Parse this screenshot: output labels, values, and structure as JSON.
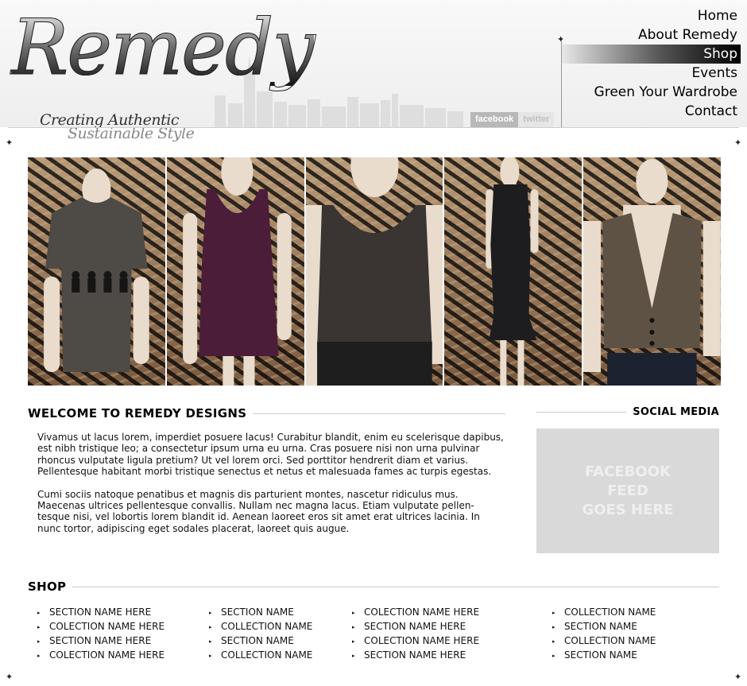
{
  "header": {
    "logo_text": "Remedy",
    "tagline_line1": "Creating Authentic",
    "tagline_line2": "Sustainable Style",
    "social_links": [
      "facebook",
      "twitter"
    ],
    "nav": {
      "items": [
        {
          "label": "Home",
          "active": false
        },
        {
          "label": "About Remedy",
          "active": false
        },
        {
          "label": "Shop",
          "active": true
        },
        {
          "label": "Events",
          "active": false
        },
        {
          "label": "Green Your Wardrobe",
          "active": false
        },
        {
          "label": "Contact",
          "active": false
        }
      ]
    }
  },
  "gallery": {
    "photos": [
      {
        "name": "gray-beatles-tee",
        "garment_color": "#4e4a45"
      },
      {
        "name": "purple-tank-dress",
        "garment_color": "#4c1d38"
      },
      {
        "name": "sequin-tank-top",
        "garment_color": "#3a3432"
      },
      {
        "name": "black-sequin-dress",
        "garment_color": "#1d1d1f"
      },
      {
        "name": "plaid-vest",
        "garment_color": "#5e5244"
      }
    ]
  },
  "welcome": {
    "title": "WELCOME TO REMEDY DESIGNS",
    "paragraphs": [
      "Vivamus ut lacus lorem, imperdiet posuere lacus! Curabitur blandit, enim eu scelerisque dapibus, est nibh tristique leo; a consectetur ipsum urna eu urna. Cras posuere nisi non urna pulvinar rhoncus vulputate ligula pretium? Ut vel lorem orci. Sed porttitor hendrerit diam et varius. Pellentesque habitant morbi tristique senectus et netus et malesuada fames ac turpis egestas.",
      "Cumi sociis natoque penatibus et magnis dis parturient montes, nascetur ridiculus mus. Maecenas ultrices pellentesque convallis. Nullam nec magna lacus. Etiam vulputate pellen-tesque nisi, vel lobortis lorem blandit id. Aenean laoreet eros sit amet erat ultrices lacinia. In nunc tortor, adipiscing eget sodales placerat, laoreet quis augue."
    ]
  },
  "social": {
    "title": "SOCIAL MEDIA",
    "placeholder": "FACEBOOK\nFEED\nGOES HERE"
  },
  "shop": {
    "title": "SHOP",
    "columns": [
      [
        "SECTION NAME HERE",
        "COLECTION NAME HERE",
        "SECTION NAME HERE",
        "COLECTION NAME HERE"
      ],
      [
        "SECTION NAME",
        "COLLECTION NAME",
        "SECTION NAME",
        "COLLECTION NAME"
      ],
      [
        "COLECTION NAME HERE",
        "SECTION NAME HERE",
        "COLECTION NAME HERE",
        "SECTION NAME HERE"
      ],
      [
        "COLLECTION NAME",
        "SECTION NAME",
        "COLLECTION NAME",
        "SECTION NAME"
      ]
    ]
  },
  "colors": {
    "nav_active_start": "#e8e8e8",
    "nav_active_end": "#000000",
    "facebook_box_bg": "#d9d9d9",
    "rule": "#cccccc"
  },
  "icons": {
    "bullet": "▸",
    "corner": "✦"
  }
}
